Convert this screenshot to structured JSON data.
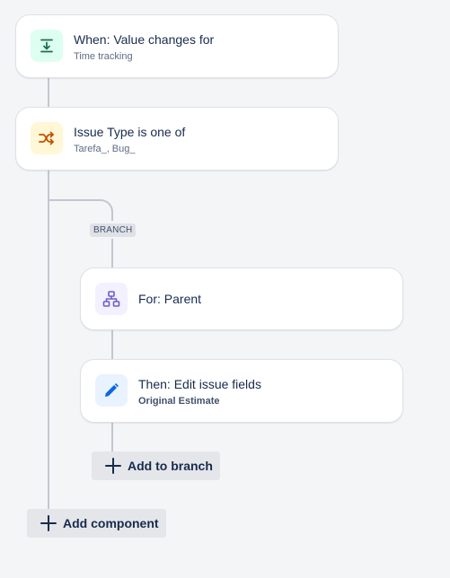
{
  "trigger": {
    "title": "When: Value changes for",
    "subtitle": "Time tracking",
    "icon": "field-change-icon",
    "icon_bg": "#dcfff1",
    "icon_color": "#216e4e"
  },
  "condition": {
    "title": "Issue Type is one of",
    "subtitle": "Tarefa_, Bug_",
    "icon": "shuffle-icon",
    "icon_bg": "#fff7d6",
    "icon_color": "#c25100"
  },
  "branch_label": "BRANCH",
  "branch": {
    "title": "For: Parent",
    "icon": "hierarchy-icon",
    "icon_bg": "#f3f0ff",
    "icon_color": "#6e5dc6"
  },
  "action": {
    "title": "Then: Edit issue fields",
    "subtitle": "Original Estimate",
    "icon": "pencil-icon",
    "icon_bg": "#e9f2ff",
    "icon_color": "#0c66e4"
  },
  "add_to_branch_label": "Add to branch",
  "add_component_label": "Add component"
}
